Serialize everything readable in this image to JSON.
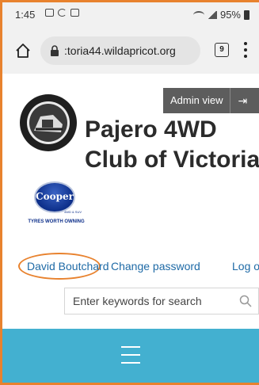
{
  "status_bar": {
    "time": "1:45",
    "battery": "95%",
    "icons": [
      "image-icon",
      "sync-icon",
      "checkbox-icon",
      "wifi-icon",
      "signal-icon",
      "battery-icon"
    ]
  },
  "browser": {
    "url": ":toria44.wildapricot.org",
    "tab_count": "9"
  },
  "admin": {
    "label": "Admin view"
  },
  "site": {
    "title_line1": "Pajero 4WD",
    "title_line2": "Club of Victoria",
    "logo_ring_top": "PAJERO",
    "logo_ring_bottom": "4WD CLUB VIC"
  },
  "sponsor": {
    "name": "Cooper",
    "sub": "4WD & SUV",
    "tagline": "TYRES WORTH OWNING"
  },
  "user_links": {
    "user_name": "David Boutchard",
    "change_password": "Change password",
    "log_out": "Log out"
  },
  "search": {
    "placeholder": "Enter keywords for search"
  },
  "colors": {
    "nav_bar": "#43b0d0",
    "link": "#1e6aa6",
    "highlight": "#e8822e",
    "admin_bar": "#5d5d5d"
  }
}
